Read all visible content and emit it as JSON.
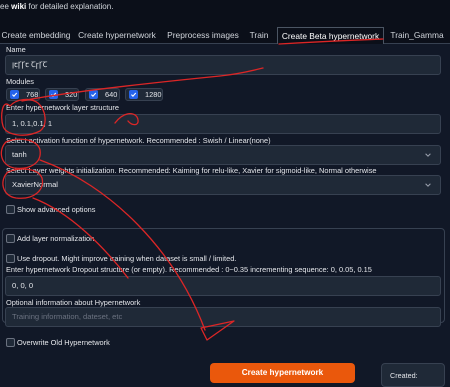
{
  "top_note": {
    "prefix": "ee ",
    "bold": "wiki",
    "suffix": " for detailed explanation."
  },
  "tabs": [
    {
      "label": "Create embedding"
    },
    {
      "label": "Create hypernetwork"
    },
    {
      "label": "Preprocess images"
    },
    {
      "label": "Train"
    },
    {
      "label": "Create Beta hypernetwork"
    },
    {
      "label": "Train_Gamma"
    }
  ],
  "form": {
    "name_label": "Name",
    "name_value": "ꞁꞇꞄꞄꞇ ꞆꞅꞄꞆ",
    "modules_label": "Modules",
    "modules": [
      {
        "label": "768",
        "checked": true
      },
      {
        "label": "320",
        "checked": true
      },
      {
        "label": "640",
        "checked": true
      },
      {
        "label": "1280",
        "checked": true
      }
    ],
    "layer_structure_label": "Enter hypernetwork layer structure",
    "layer_structure_value": "1, 0.1,0.1, 1",
    "activation_label": "Select activation function of hypernetwork. Recommended : Swish / Linear(none)",
    "activation_value": "tanh",
    "init_label": "Select Layer weights initialization. Recommended: Kaiming for relu-like, Xavier for sigmoid-like, Normal otherwise",
    "init_value": "XavierNormal",
    "show_advanced_label": "Show advanced options",
    "add_layer_norm_label": "Add layer normalization",
    "dropout_label": "Use dropout. Might improve training when dataset is small / limited.",
    "dropout_structure_label": "Enter hypernetwork Dropout structure (or empty). Recommended : 0~0.35 incrementing sequence: 0, 0.05, 0.15",
    "dropout_structure_value": "0, 0, 0",
    "optional_info_label": "Optional information about Hypernetwork",
    "optional_info_placeholder": "Training information, dateset, etc",
    "overwrite_label": "Overwrite Old Hypernetwork"
  },
  "create_button_label": "Create hypernetwork",
  "created_label": "Created:",
  "colors": {
    "accent": "#2563eb",
    "button": "#ea580c",
    "annotation": "#dc2626"
  }
}
